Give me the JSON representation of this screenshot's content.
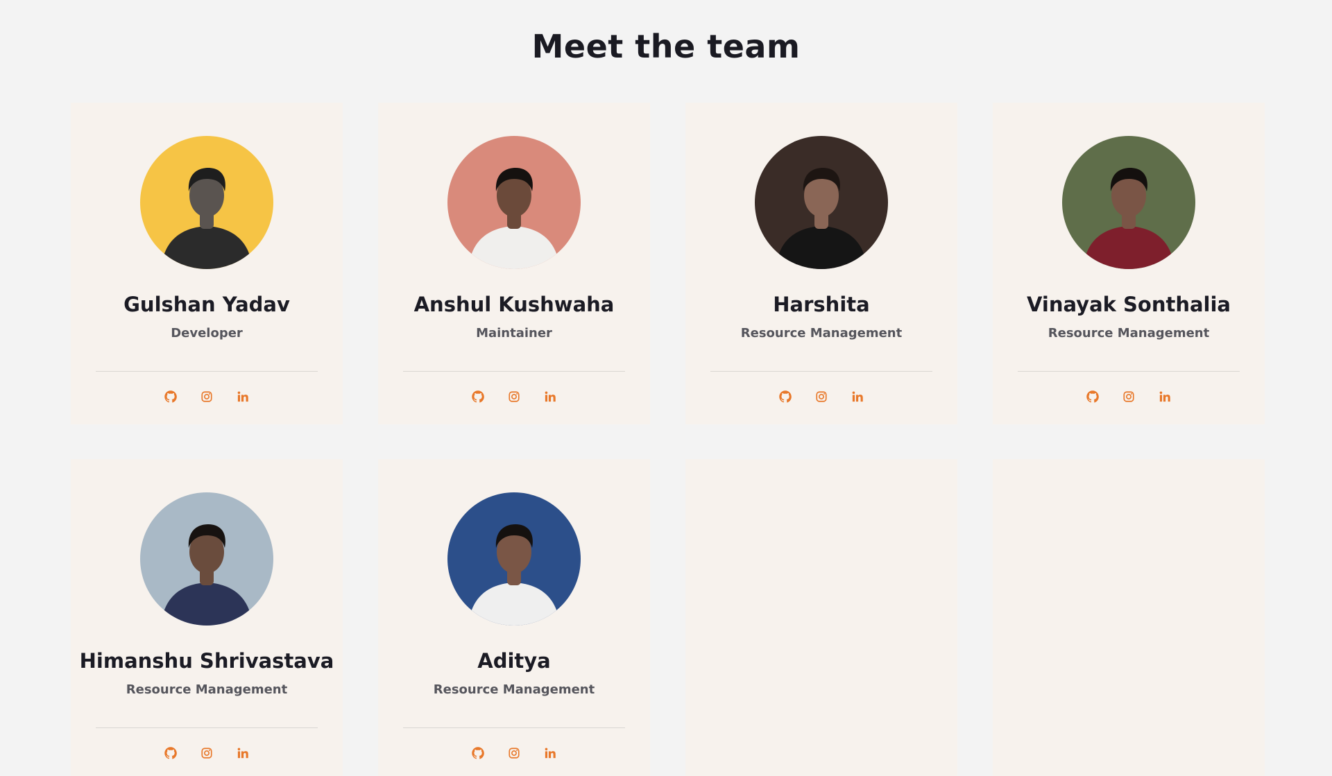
{
  "section": {
    "title": "Meet the team"
  },
  "accent_color": "#e8782a",
  "members": [
    {
      "name": "Gulshan Yadav",
      "role": "Developer",
      "avatar_bg": "#f6c445",
      "shirt": "#2b2b2b",
      "skin": "#5a5450",
      "hair": "#1e1e1e"
    },
    {
      "name": "Anshul Kushwaha",
      "role": "Maintainer",
      "avatar_bg": "#d98a7b",
      "shirt": "#f0efed",
      "skin": "#6b4a3a",
      "hair": "#15110f"
    },
    {
      "name": "Harshita",
      "role": "Resource Management",
      "avatar_bg": "#3a2c27",
      "shirt": "#151515",
      "skin": "#8a6656",
      "hair": "#1d1512"
    },
    {
      "name": "Vinayak Sonthalia",
      "role": "Resource Management",
      "avatar_bg": "#5f6e4a",
      "shirt": "#7e1f2c",
      "skin": "#7a5546",
      "hair": "#14100e"
    },
    {
      "name": "Himanshu Shrivastava",
      "role": "Resource Management",
      "avatar_bg": "#a9b9c6",
      "shirt": "#2c3457",
      "skin": "#6a4c3d",
      "hair": "#171210"
    },
    {
      "name": "Aditya",
      "role": "Resource Management",
      "avatar_bg": "#2c4f8a",
      "shirt": "#efefef",
      "skin": "#7a5646",
      "hair": "#15110f"
    }
  ],
  "icons": [
    "github-icon",
    "instagram-icon",
    "linkedin-icon"
  ]
}
